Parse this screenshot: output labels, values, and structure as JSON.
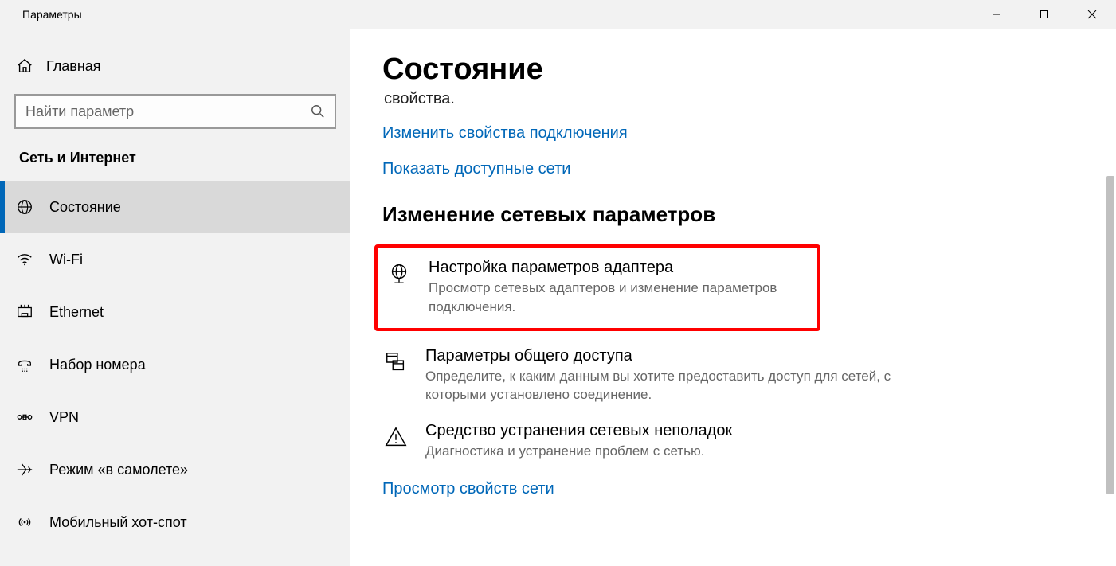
{
  "window": {
    "title": "Параметры"
  },
  "sidebar": {
    "home": "Главная",
    "search_placeholder": "Найти параметр",
    "section": "Сеть и Интернет",
    "items": [
      {
        "icon": "globe-icon",
        "label": "Состояние",
        "active": true
      },
      {
        "icon": "wifi-icon",
        "label": "Wi-Fi",
        "active": false
      },
      {
        "icon": "ethernet-icon",
        "label": "Ethernet",
        "active": false
      },
      {
        "icon": "dialup-icon",
        "label": "Набор номера",
        "active": false
      },
      {
        "icon": "vpn-icon",
        "label": "VPN",
        "active": false
      },
      {
        "icon": "airplane-icon",
        "label": "Режим «в самолете»",
        "active": false
      },
      {
        "icon": "hotspot-icon",
        "label": "Мобильный хот-спот",
        "active": false
      }
    ]
  },
  "main": {
    "title": "Состояние",
    "stray_text": "свойства.",
    "link_change_props": "Изменить свойства подключения",
    "link_show_networks": "Показать доступные сети",
    "section_header": "Изменение сетевых параметров",
    "option_adapter_title": "Настройка параметров адаптера",
    "option_adapter_desc": "Просмотр сетевых адаптеров и изменение параметров подключения.",
    "option_sharing_title": "Параметры общего доступа",
    "option_sharing_desc": "Определите, к каким данным вы хотите предоставить доступ для сетей, с которыми установлено соединение.",
    "option_trouble_title": "Средство устранения сетевых неполадок",
    "option_trouble_desc": "Диагностика и устранение проблем с сетью.",
    "link_view_props": "Просмотр свойств сети"
  }
}
